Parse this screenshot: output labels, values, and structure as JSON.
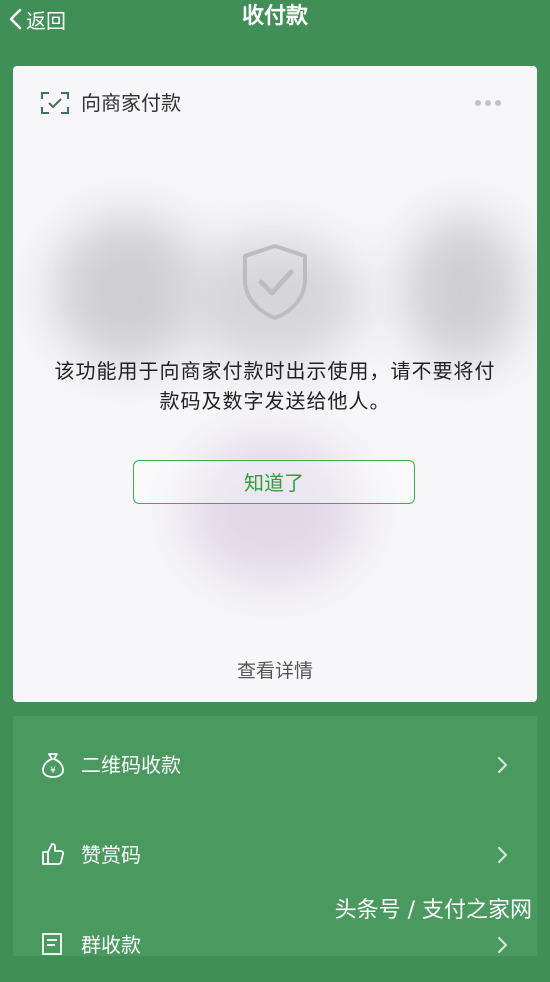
{
  "nav": {
    "back_label": "返回",
    "title": "收付款"
  },
  "card": {
    "title": "向商家付款",
    "notice": "该功能用于向商家付款时出示使用，请不要将付款码及数字发送给他人。",
    "ok_button": "知道了",
    "detail_link": "查看详情"
  },
  "menu": {
    "items": [
      {
        "label": "二维码收款",
        "icon": "money-bag-icon"
      },
      {
        "label": "赞赏码",
        "icon": "thumbs-up-icon"
      },
      {
        "label": "群收款",
        "icon": "group-receipt-icon"
      }
    ]
  },
  "watermark": "头条号 / 支付之家网",
  "colors": {
    "background": "#3f8f57",
    "accent": "#3fae4c",
    "card": "#f7f7f9"
  }
}
